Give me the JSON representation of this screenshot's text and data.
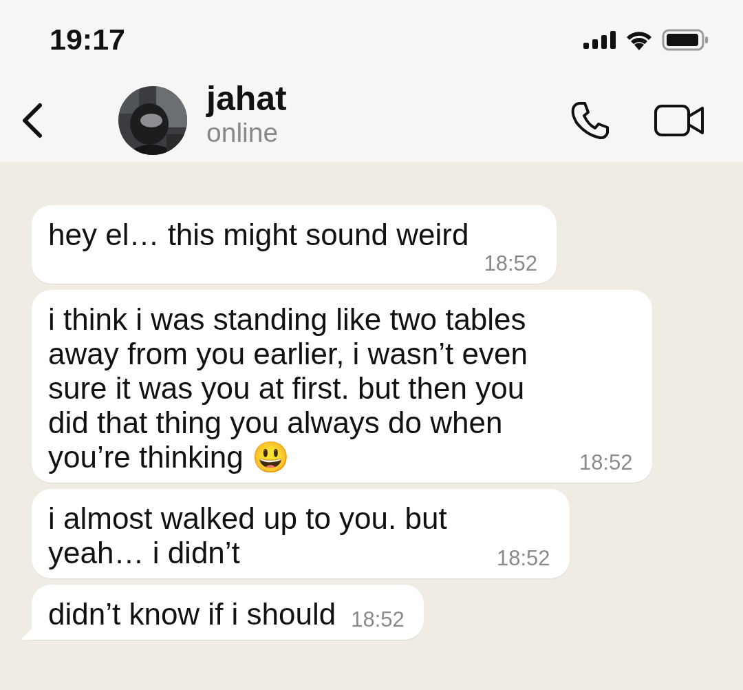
{
  "status_bar": {
    "time": "19:17"
  },
  "header": {
    "name": "jahat",
    "status": "online"
  },
  "messages": [
    {
      "text": "hey el… this might sound weird",
      "time": "18:52",
      "tail": false
    },
    {
      "text": "i think i was standing like two tables away from you earlier, i wasn’t even sure it was you at first. but then you did that thing you always do when you’re thinking 😃",
      "time": "18:52",
      "tail": false
    },
    {
      "text": "i almost walked up to you. but yeah… i didn’t",
      "time": "18:52",
      "tail": false
    },
    {
      "text": "didn’t know if i should",
      "time": "18:52",
      "tail": true
    }
  ]
}
